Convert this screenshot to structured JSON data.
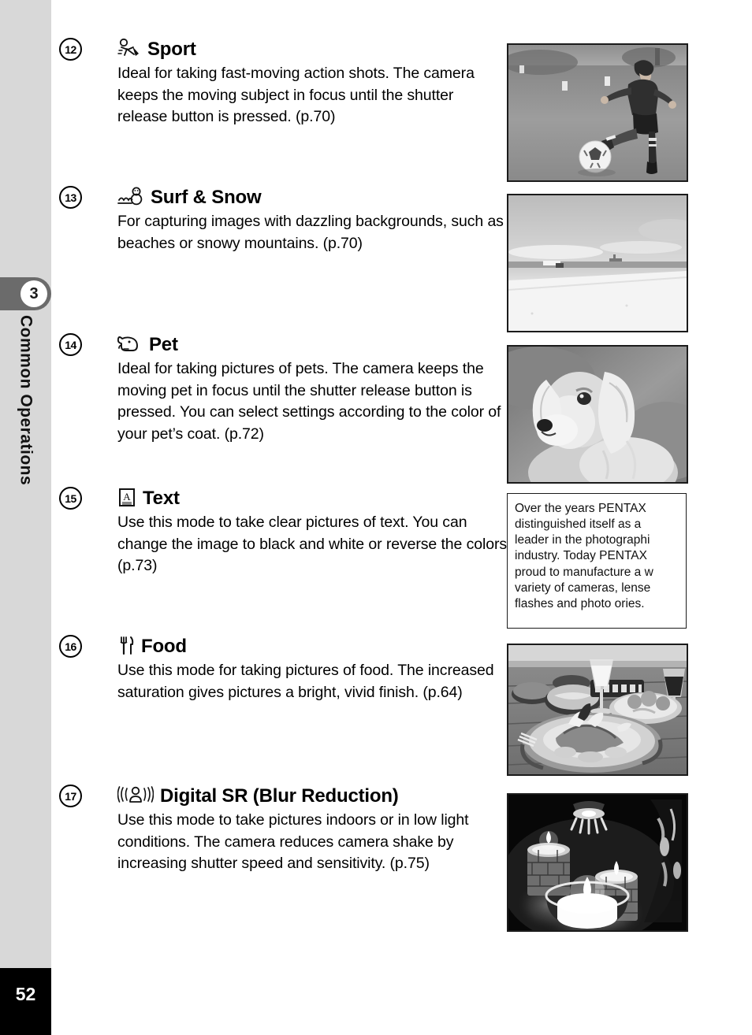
{
  "sidebar": {
    "chapter_number": "3",
    "chapter_title": "Common Operations",
    "page_number": "52"
  },
  "entries": [
    {
      "number": "12",
      "icon": "running-person-icon",
      "title": "Sport",
      "description": "Ideal for taking fast-moving action shots. The camera keeps the moving subject in focus until the shutter release button is pressed. (p.70)",
      "photo_caption": "boy kicking a soccer ball on a grass field"
    },
    {
      "number": "13",
      "icon": "snowman-wave-icon",
      "title": "Surf & Snow",
      "description": "For capturing images with dazzling backgrounds, such as beaches or snowy mountains. (p.70)",
      "photo_caption": "bright beach with sea and sky horizon"
    },
    {
      "number": "14",
      "icon": "dog-head-icon",
      "title": "Pet",
      "description": "Ideal for taking pictures of pets. The camera keeps the moving pet in focus until the shutter release button is pressed. You can select settings according to the color of your pet’s coat. (p.72)",
      "photo_caption": "long-haired dachshund puppy portrait"
    },
    {
      "number": "15",
      "icon": "text-document-icon",
      "title": "Text",
      "description": "Use this mode to take clear pictures of text. You can change the image to black and white or reverse the colors. (p.73)",
      "photo_caption": "close-up photograph of printed text"
    },
    {
      "number": "16",
      "icon": "fork-knife-icon",
      "title": "Food",
      "description": "Use this mode for taking pictures of food. The increased saturation gives pictures a bright, vivid finish. (p.64)",
      "photo_caption": "plates of food and drinks on a wooden table"
    },
    {
      "number": "17",
      "icon": "blur-reduction-person-icon",
      "title": "Digital SR (Blur Reduction)",
      "description": "Use this mode to take pictures indoors or in low light conditions. The camera reduces camera shake by increasing shutter speed and sensitivity. (p.75)",
      "photo_caption": "lit candles in glass holders in a dark room"
    }
  ],
  "text_sample_photo": {
    "lines": [
      "Over the years PENTAX",
      "distinguished itself as a",
      "leader in the photographi",
      "industry. Today PENTAX",
      "proud to manufacture a w",
      "variety of cameras, lense",
      "flashes and photo ories."
    ]
  },
  "colors": {
    "sidebar_background": "#d8d8d8",
    "chapter_tab": "#6b6b6b",
    "page_block": "#000000",
    "text": "#000000"
  }
}
